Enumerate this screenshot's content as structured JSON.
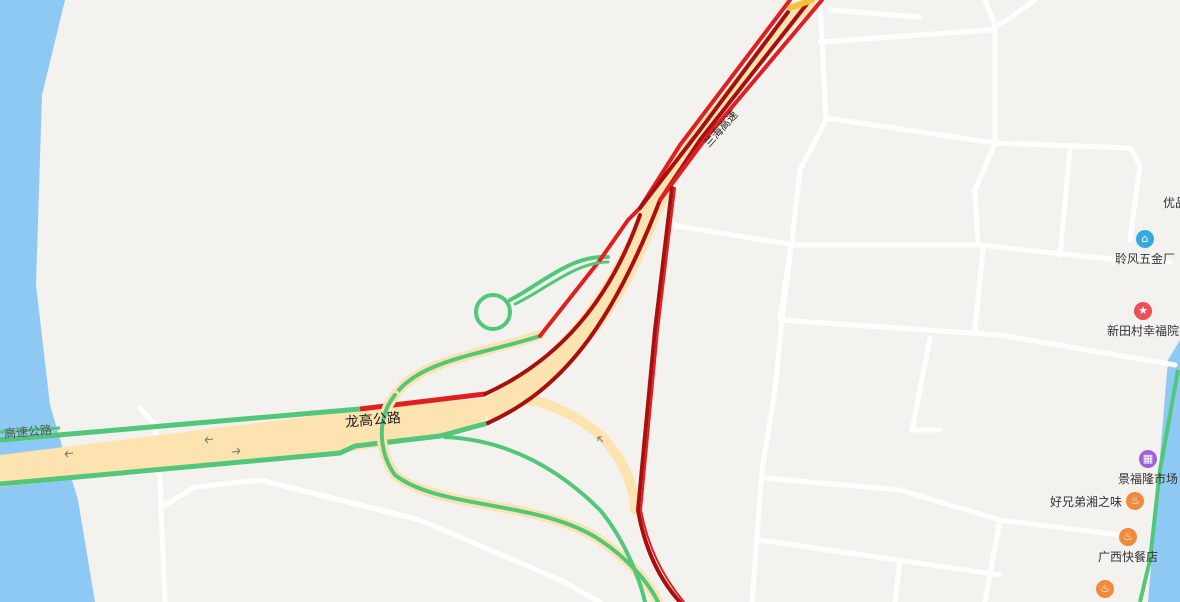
{
  "map": {
    "roads": {
      "main_road": "龙高公路",
      "expressway": "兰海高速",
      "river_road_fragment": "高速公路"
    },
    "pois": [
      {
        "label": "优品",
        "icon": "none-icon",
        "color": ""
      },
      {
        "label": "聆风五金厂",
        "icon": "shop-icon",
        "color": "#35a8dc"
      },
      {
        "label": "新田村幸福院",
        "icon": "star-icon",
        "color": "#e9505a"
      },
      {
        "label": "景福隆市场",
        "icon": "market-icon",
        "color": "#9c62d6"
      },
      {
        "label": "好兄弟湘之味",
        "icon": "restaurant-icon",
        "color": "#f08a3c"
      },
      {
        "label": "广西快餐店",
        "icon": "restaurant-icon",
        "color": "#f08a3c"
      },
      {
        "label": "",
        "icon": "restaurant-icon",
        "color": "#f08a3c"
      }
    ],
    "traffic_colors": {
      "smooth": "#52c77a",
      "slow": "#e02020",
      "congested": "#a80f0f"
    },
    "water_color": "#8ec9f4"
  }
}
